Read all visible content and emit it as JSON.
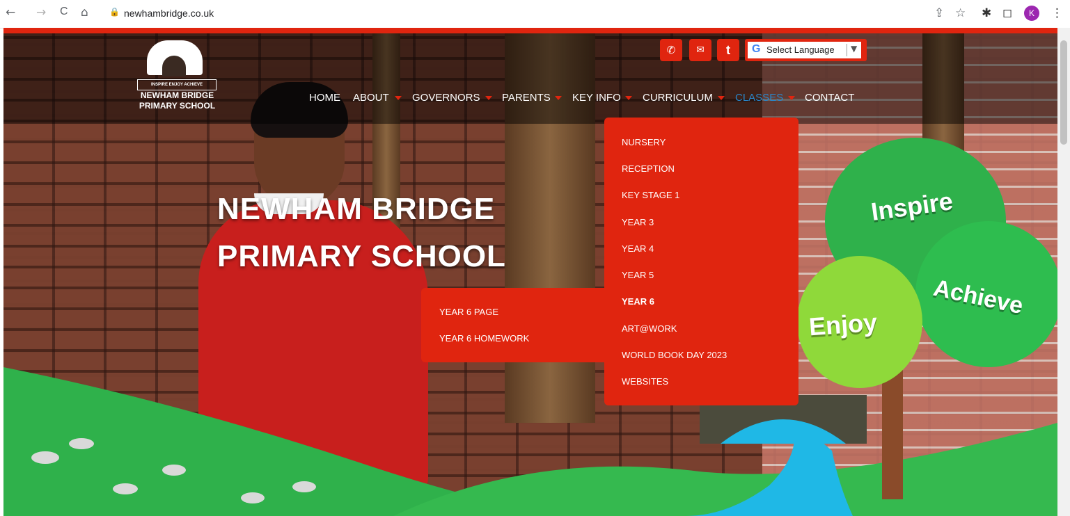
{
  "browser": {
    "url": "newhambridge.co.uk",
    "back_icon": "←",
    "forward_icon": "→",
    "reload_icon": "C",
    "home_icon": "⌂",
    "lock_icon": "🔒",
    "share_icon": "⇪",
    "star_icon": "☆",
    "extensions_icon": "✱",
    "sidepanel_icon": "◻",
    "avatar_letter": "K",
    "menu_icon": "⋮"
  },
  "logo": {
    "motto": "INSPIRE  ENJOY  ACHIEVE",
    "name_line1": "NEWHAM BRIDGE",
    "name_line2": "PRIMARY SCHOOL"
  },
  "contact_icons": {
    "phone": "✆",
    "email": "✉",
    "twitter": "t"
  },
  "language": {
    "g": "G",
    "label": "Select Language",
    "arrow": "▼"
  },
  "nav": {
    "home": "HOME",
    "about": "ABOUT",
    "governors": "GOVERNORS",
    "parents": "PARENTS",
    "key_info": "KEY INFO",
    "curriculum": "CURRICULUM",
    "classes": "CLASSES",
    "contact": "CONTACT"
  },
  "hero": {
    "title_line1": "NEWHAM BRIDGE",
    "title_line2": "PRIMARY SCHOOL",
    "word_inspire": "Inspire",
    "word_enjoy": "Enjoy",
    "word_achieve": "Achieve"
  },
  "classes_menu": [
    "NURSERY",
    "RECEPTION",
    "KEY STAGE 1",
    "YEAR 3",
    "YEAR 4",
    "YEAR 5",
    "YEAR 6",
    "ART@WORK",
    "WORLD BOOK DAY 2023",
    "WEBSITES"
  ],
  "year6_submenu": [
    "YEAR 6 PAGE",
    "YEAR 6 HOMEWORK"
  ],
  "colors": {
    "accent_red": "#e0250f",
    "active_blue": "#2a86c9",
    "grass_green": "#2fb14b"
  }
}
